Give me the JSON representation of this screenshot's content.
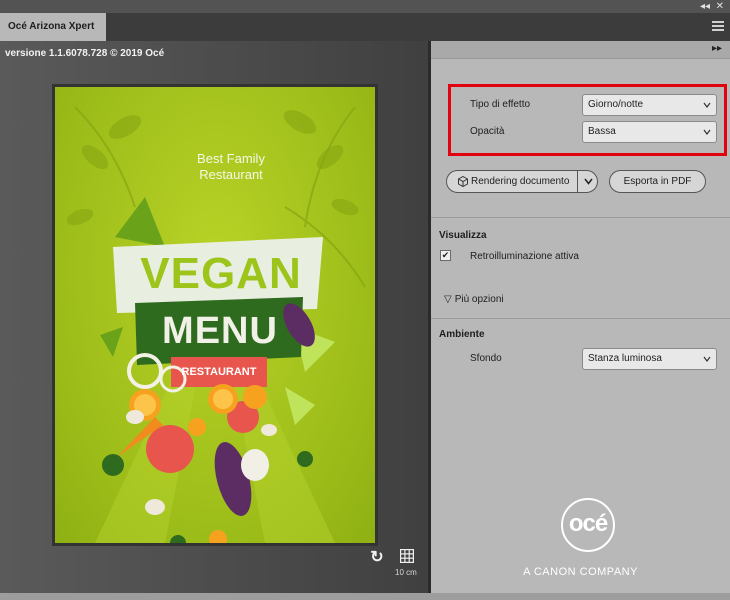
{
  "window": {
    "tab_title": "Océ Arizona Xpert",
    "collapse_glyph": "◂◂",
    "close_glyph": "✕"
  },
  "viewer": {
    "version_text": "versione 1.1.6078.728 © 2019 Océ",
    "scale_label": "10 cm",
    "poster": {
      "tagline_line1": "Best Family",
      "tagline_line2": "Restaurant",
      "headline1": "VEGAN",
      "headline2": "MENU",
      "badge": "RESTAURANT"
    }
  },
  "panel": {
    "expand_glyph": "▸▸",
    "effect_type_label": "Tipo di effetto",
    "effect_type_value": "Giorno/notte",
    "opacity_label": "Opacità",
    "opacity_value": "Bassa",
    "render_button_label": "Rendering documento",
    "export_button_label": "Esporta in PDF",
    "view_section_title": "Visualizza",
    "backlight_label": "Retroilluminazione attiva",
    "backlight_checked": true,
    "more_options_label": "Più opzioni",
    "environment_section_title": "Ambiente",
    "background_label": "Sfondo",
    "background_value": "Stanza luminosa",
    "logo_text": "océ",
    "company_tagline": "A CANON COMPANY"
  },
  "colors": {
    "highlight": "#e3000f",
    "poster_green": "#a8c41f",
    "menu_dark_green": "#2f6b1f",
    "badge_red": "#e8554c"
  }
}
